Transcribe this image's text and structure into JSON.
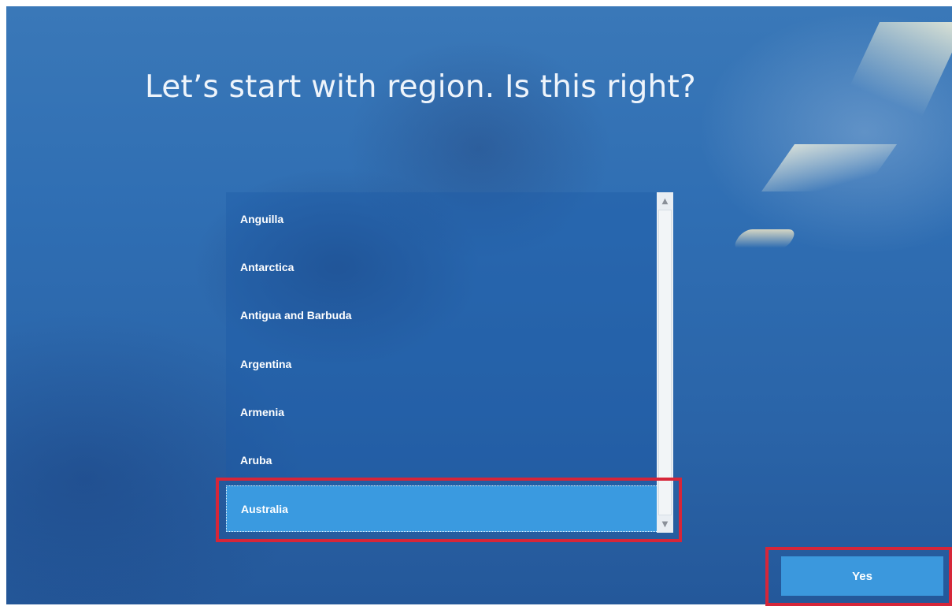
{
  "page": {
    "title": "Let’s start with region. Is this right?"
  },
  "region_list": {
    "items": [
      {
        "label": "Anguilla",
        "selected": false
      },
      {
        "label": "Antarctica",
        "selected": false
      },
      {
        "label": "Antigua and Barbuda",
        "selected": false
      },
      {
        "label": "Argentina",
        "selected": false
      },
      {
        "label": "Armenia",
        "selected": false
      },
      {
        "label": "Aruba",
        "selected": false
      },
      {
        "label": "Australia",
        "selected": true
      }
    ],
    "scrollbar": {
      "up_icon": "chevron-up-icon",
      "down_icon": "chevron-down-icon"
    }
  },
  "actions": {
    "yes_label": "Yes"
  },
  "colors": {
    "background": "#2f6eb3",
    "selected_item": "#3a9ae0",
    "primary_button": "#3b98dd",
    "highlight_border": "#d62639",
    "scrollbar_track": "#e9eef3"
  }
}
